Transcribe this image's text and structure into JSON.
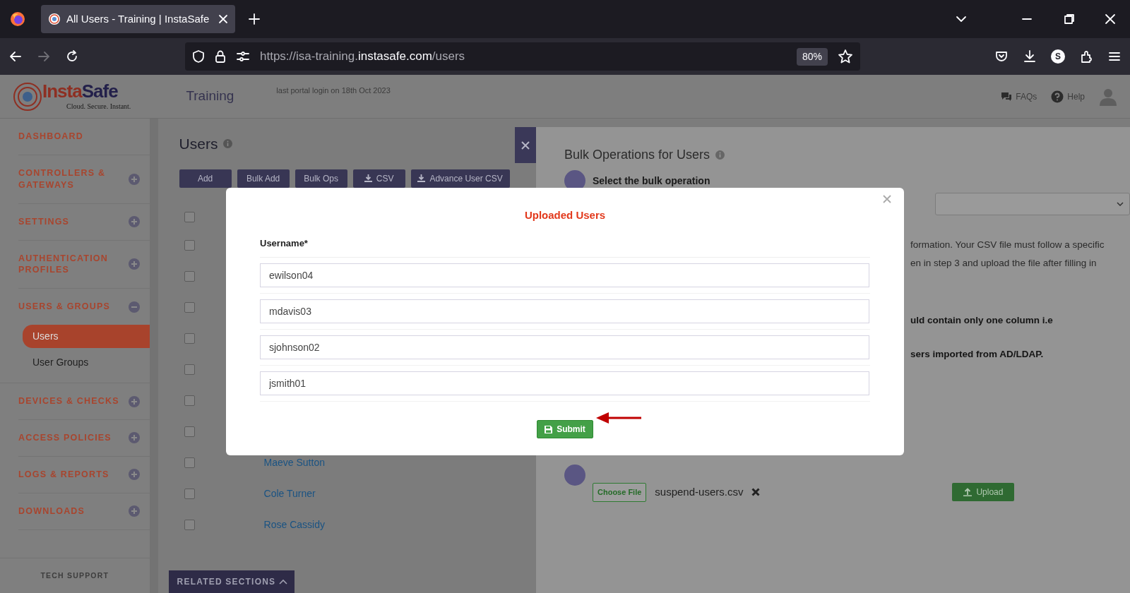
{
  "browser": {
    "tab": {
      "title": "All Users - Training | InstaSafe",
      "selected": true
    },
    "url": {
      "host_prefix": "https://isa-training.",
      "domain": "instasafe.com",
      "path": "/users"
    },
    "zoom": "80%",
    "account_initial": "S"
  },
  "header": {
    "logo": {
      "part1": "Insta",
      "part2": "Safe",
      "tagline": "Cloud. Secure. Instant."
    },
    "portal": "Training",
    "last_login": "last portal login on 18th Oct 2023",
    "links": [
      "FAQs",
      "Help"
    ]
  },
  "sidebar": {
    "items": [
      {
        "label": "DASHBOARD",
        "kind": "link"
      },
      {
        "label": "CONTROLLERS & GATEWAYS",
        "kind": "group",
        "expanded": false
      },
      {
        "label": "SETTINGS",
        "kind": "group",
        "expanded": false
      },
      {
        "label": "AUTHENTICATION PROFILES",
        "kind": "group",
        "expanded": false
      },
      {
        "label": "USERS & GROUPS",
        "kind": "group",
        "expanded": true,
        "children": [
          {
            "label": "Users",
            "selected": true
          },
          {
            "label": "User Groups",
            "selected": false
          }
        ]
      },
      {
        "label": "DEVICES & CHECKS",
        "kind": "group",
        "expanded": false
      },
      {
        "label": "ACCESS POLICIES",
        "kind": "group",
        "expanded": false
      },
      {
        "label": "LOGS & REPORTS",
        "kind": "group",
        "expanded": false
      },
      {
        "label": "DOWNLOADS",
        "kind": "group",
        "expanded": false
      }
    ],
    "footer": "TECH SUPPORT"
  },
  "users": {
    "title": "Users",
    "buttons": [
      {
        "label": "Add",
        "kind": "plain"
      },
      {
        "label": "Bulk Add",
        "kind": "plain"
      },
      {
        "label": "Bulk Ops",
        "kind": "plain"
      },
      {
        "label": "CSV",
        "kind": "download"
      },
      {
        "label": "Advance User CSV",
        "kind": "download"
      }
    ],
    "select_all": {
      "checked": false
    },
    "rows": [
      {
        "checked": false
      },
      {
        "checked": false
      },
      {
        "checked": false
      },
      {
        "checked": false
      },
      {
        "checked": false
      },
      {
        "checked": false
      },
      {
        "checked": false
      },
      {
        "name": "Maeve Sutton",
        "checked": false
      },
      {
        "name": "Cole Turner",
        "checked": false
      },
      {
        "name": "Rose Cassidy",
        "checked": false
      }
    ],
    "related": "RELATED SECTIONS"
  },
  "bulk_panel": {
    "title": "Bulk Operations for Users",
    "step_label": "Select the bulk operation",
    "lines": [
      {
        "text": "formation. Your CSV file must follow a specific",
        "bold": false
      },
      {
        "text": "en in step 3 and upload the file after filling in",
        "bold": false
      },
      {
        "text": "uld contain only one column i.e",
        "bold": true
      },
      {
        "text": "sers imported from AD/LDAP.",
        "bold": true
      }
    ],
    "file_button": "Choose File",
    "file_name": "suspend-users.csv",
    "upload": "Upload"
  },
  "modal": {
    "title": "Uploaded Users",
    "field_label": "Username*",
    "usernames": [
      "ewilson04",
      "mdavis03",
      "sjohnson02",
      "jsmith01"
    ],
    "submit": "Submit"
  }
}
